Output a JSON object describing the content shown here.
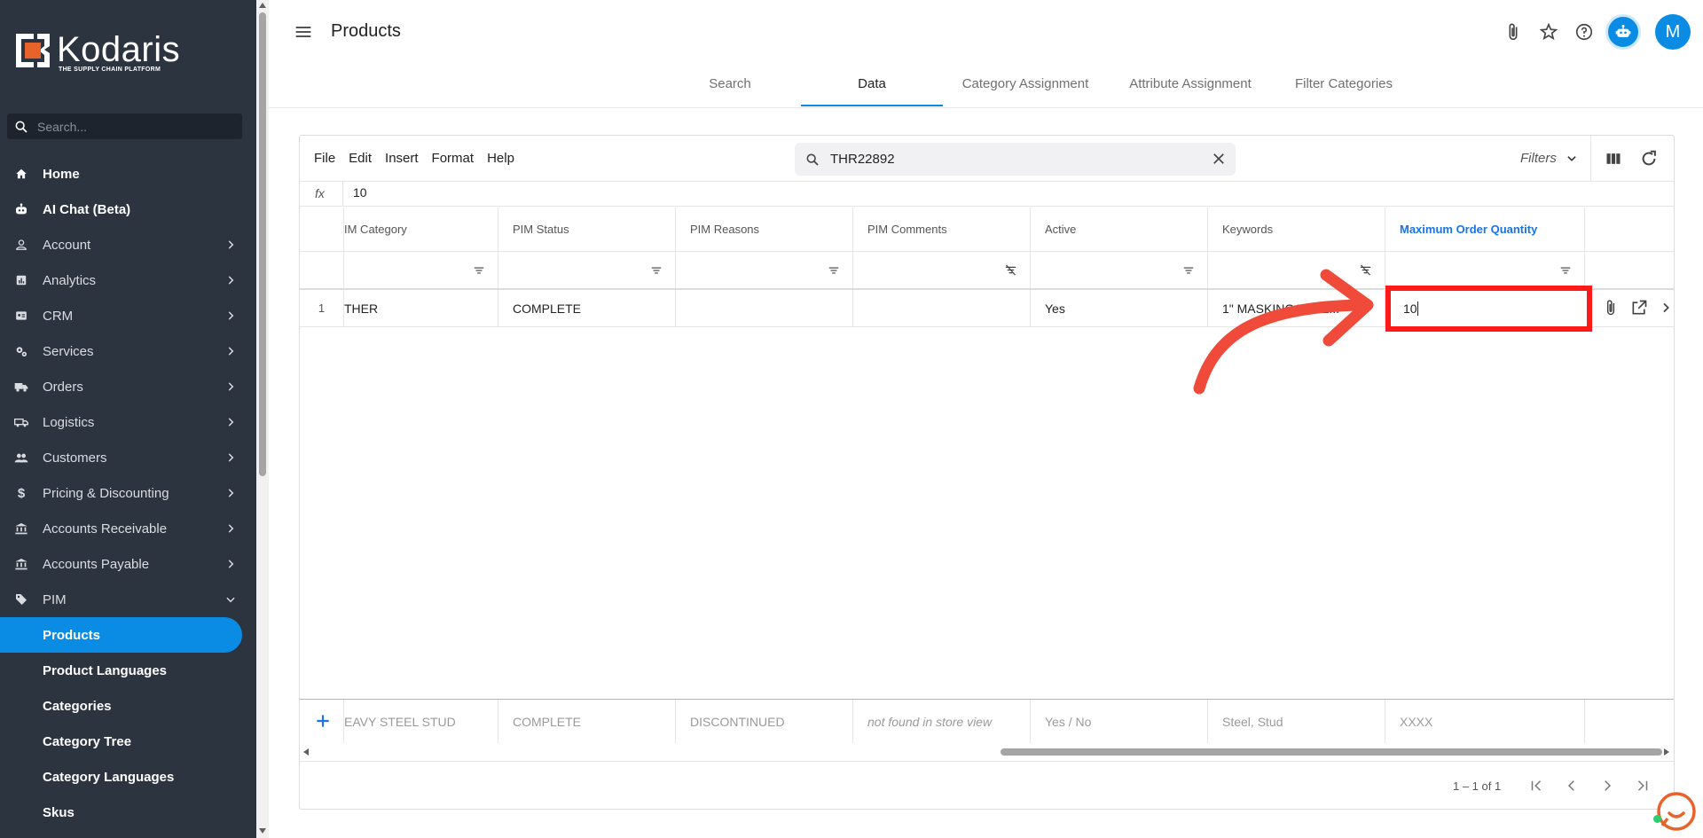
{
  "brand": {
    "name": "Kodaris",
    "tagline": "THE SUPPLY CHAIN PLATFORM",
    "logo_color": "#e8632b"
  },
  "sidebar": {
    "search_placeholder": "Search...",
    "items": [
      {
        "label": "Home",
        "icon": "home-icon"
      },
      {
        "label": "AI Chat (Beta)",
        "icon": "robot-icon"
      },
      {
        "label": "Account",
        "icon": "person-icon"
      },
      {
        "label": "Analytics",
        "icon": "analytics-icon"
      },
      {
        "label": "CRM",
        "icon": "contact-card-icon"
      },
      {
        "label": "Services",
        "icon": "gears-icon"
      },
      {
        "label": "Orders",
        "icon": "truck-icon"
      },
      {
        "label": "Logistics",
        "icon": "shipping-truck-icon"
      },
      {
        "label": "Customers",
        "icon": "people-icon"
      },
      {
        "label": "Pricing & Discounting",
        "icon": "dollar-icon"
      },
      {
        "label": "Accounts Receivable",
        "icon": "bank-icon"
      },
      {
        "label": "Accounts Payable",
        "icon": "bank-icon"
      },
      {
        "label": "PIM",
        "icon": "tag-icon"
      }
    ],
    "pim_children": [
      "Products",
      "Product Languages",
      "Categories",
      "Category Tree",
      "Category Languages",
      "Skus"
    ],
    "active_child": "Products",
    "active_color": "#0a8ce4"
  },
  "header": {
    "title": "Products",
    "avatar_initial": "M",
    "tabs": [
      "Search",
      "Data",
      "Category Assignment",
      "Attribute Assignment",
      "Filter Categories"
    ],
    "active_tab": "Data"
  },
  "grid": {
    "menu": [
      "File",
      "Edit",
      "Insert",
      "Format",
      "Help"
    ],
    "search_value": "THR22892",
    "filters_label": "Filters",
    "fx_label": "fx",
    "formula_value": "10",
    "columns": [
      "IM Category",
      "PIM Status",
      "PIM Reasons",
      "PIM Comments",
      "Active",
      "Keywords",
      "Maximum Order Quantity"
    ],
    "highlight_column": "Maximum Order Quantity",
    "rows": [
      {
        "num": "1",
        "cells": [
          "THER",
          "COMPLETE",
          "",
          "",
          "Yes",
          "1\" MASKING TAPE...",
          "10"
        ]
      }
    ],
    "new_row_hints": [
      "EAVY STEEL STUD",
      "COMPLETE",
      "DISCONTINUED",
      "not found in store view",
      "Yes / No",
      "Steel, Stud",
      "XXXX"
    ],
    "pagination": "1 – 1 of 1"
  },
  "annotation": {
    "color": "#ff1a1a"
  }
}
